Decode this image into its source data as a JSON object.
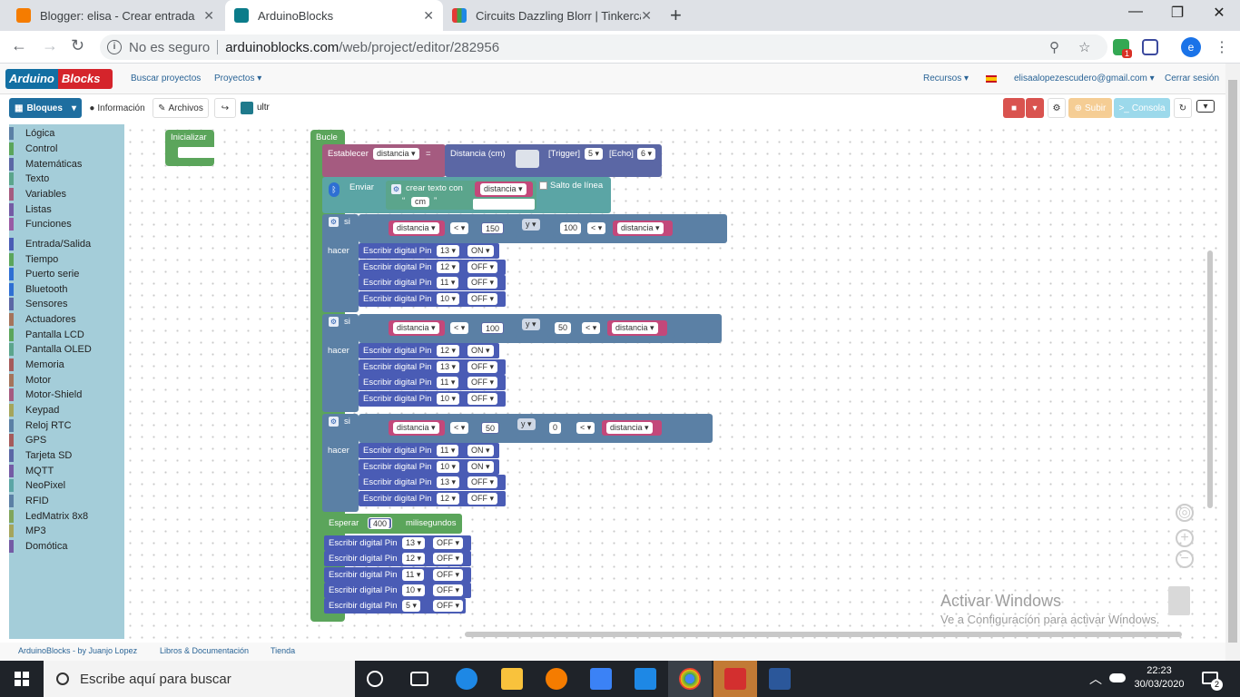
{
  "browser": {
    "tabs": [
      {
        "title": "Blogger: elisa - Crear entrada",
        "color": "#f57c00"
      },
      {
        "title": "ArduinoBlocks",
        "color": "#0b7c8a"
      },
      {
        "title": "Circuits Dazzling Blorr | Tinkercad",
        "color": "#e53935"
      }
    ],
    "security": "No es seguro",
    "url_host": "arduinoblocks.com",
    "url_path": "/web/project/editor/282956",
    "profile_initial": "e",
    "ext_badge": "1"
  },
  "app": {
    "logo_left": "Arduino",
    "logo_right": "Blocks",
    "nav": [
      "Buscar proyectos",
      "Proyectos ▾"
    ],
    "recursos": "Recursos ▾",
    "user_email": "elisaalopezescudero@gmail.com ▾",
    "logout": "Cerrar sesión"
  },
  "toolbar": {
    "bloques": "Bloques",
    "informacion": "Información",
    "archivos": "Archivos",
    "project_name": "ultr",
    "subir": "Subir",
    "consola": "Consola"
  },
  "categories": [
    {
      "label": "Lógica",
      "color": "#5b80a5"
    },
    {
      "label": "Control",
      "color": "#5ba55b"
    },
    {
      "label": "Matemáticas",
      "color": "#5b67a5"
    },
    {
      "label": "Texto",
      "color": "#5ba58c"
    },
    {
      "label": "Variables",
      "color": "#a55b80"
    },
    {
      "label": "Listas",
      "color": "#745ba5"
    },
    {
      "label": "Funciones",
      "color": "#995ba5"
    },
    {
      "label": "Entrada/Salida",
      "color": "#4a5cb5"
    },
    {
      "label": "Tiempo",
      "color": "#5ba55b"
    },
    {
      "label": "Puerto serie",
      "color": "#2e6fd3"
    },
    {
      "label": "Bluetooth",
      "color": "#2e6fd3"
    },
    {
      "label": "Sensores",
      "color": "#5b67a5"
    },
    {
      "label": "Actuadores",
      "color": "#a5745b"
    },
    {
      "label": "Pantalla LCD",
      "color": "#5ba55b"
    },
    {
      "label": "Pantalla OLED",
      "color": "#5ba58c"
    },
    {
      "label": "Memoria",
      "color": "#a55b5b"
    },
    {
      "label": "Motor",
      "color": "#a5745b"
    },
    {
      "label": "Motor-Shield",
      "color": "#a55b80"
    },
    {
      "label": "Keypad",
      "color": "#a5a55b"
    },
    {
      "label": "Reloj RTC",
      "color": "#5b80a5"
    },
    {
      "label": "GPS",
      "color": "#a55b5b"
    },
    {
      "label": "Tarjeta SD",
      "color": "#5b67a5"
    },
    {
      "label": "MQTT",
      "color": "#745ba5"
    },
    {
      "label": "NeoPixel",
      "color": "#5ba5a5"
    },
    {
      "label": "RFID",
      "color": "#5b80a5"
    },
    {
      "label": "LedMatrix 8x8",
      "color": "#80a55b"
    },
    {
      "label": "MP3",
      "color": "#a5a55b"
    },
    {
      "label": "Domótica",
      "color": "#745ba5"
    }
  ],
  "blocks": {
    "inicializar": "Inicializar",
    "bucle": "Bucle",
    "establecer": "Establecer",
    "var": "distancia",
    "eq": "=",
    "distancia_cm": "Distancia (cm)",
    "trigger": "[Trigger]",
    "trigger_pin": "5",
    "echo": "[Echo]",
    "echo_pin": "6",
    "enviar": "Enviar",
    "crear_texto": "crear texto con",
    "cm_text": "cm",
    "salto": "Salto de línea",
    "si": "si",
    "hacer": "hacer",
    "y": "y",
    "lt": "<",
    "escribir": "Escribir digital Pin",
    "esperar": "Esperar",
    "esperar_val": "400",
    "milisegundos": "milisegundos",
    "if_blocks": [
      {
        "a": "150",
        "b": "100",
        "writes": [
          [
            "13",
            "ON"
          ],
          [
            "12",
            "OFF"
          ],
          [
            "11",
            "OFF"
          ],
          [
            "10",
            "OFF"
          ]
        ]
      },
      {
        "a": "100",
        "b": "50",
        "writes": [
          [
            "12",
            "ON"
          ],
          [
            "13",
            "OFF"
          ],
          [
            "11",
            "OFF"
          ],
          [
            "10",
            "OFF"
          ]
        ]
      },
      {
        "a": "50",
        "b": "0",
        "writes": [
          [
            "11",
            "ON"
          ],
          [
            "10",
            "ON"
          ],
          [
            "13",
            "OFF"
          ],
          [
            "12",
            "OFF"
          ]
        ]
      }
    ],
    "final_writes": [
      [
        "13",
        "OFF"
      ],
      [
        "12",
        "OFF"
      ],
      [
        "11",
        "OFF"
      ],
      [
        "10",
        "OFF"
      ],
      [
        "5",
        "OFF"
      ]
    ]
  },
  "watermark": {
    "title": "Activar Windows",
    "subtitle": "Ve a Configuración para activar Windows."
  },
  "footer": [
    "ArduinoBlocks - by Juanjo Lopez",
    "Libros & Documentación",
    "Tienda"
  ],
  "taskbar": {
    "search": "Escribe aquí para buscar",
    "time": "22:23",
    "date": "30/03/2020",
    "notif_count": "2"
  },
  "colors": {
    "loop_green": "#5ba55b",
    "var_pink": "#a55b80",
    "io_blue": "#4a5cb5",
    "logic_blue": "#5b80a5",
    "bt_teal": "#5ba5a5"
  }
}
